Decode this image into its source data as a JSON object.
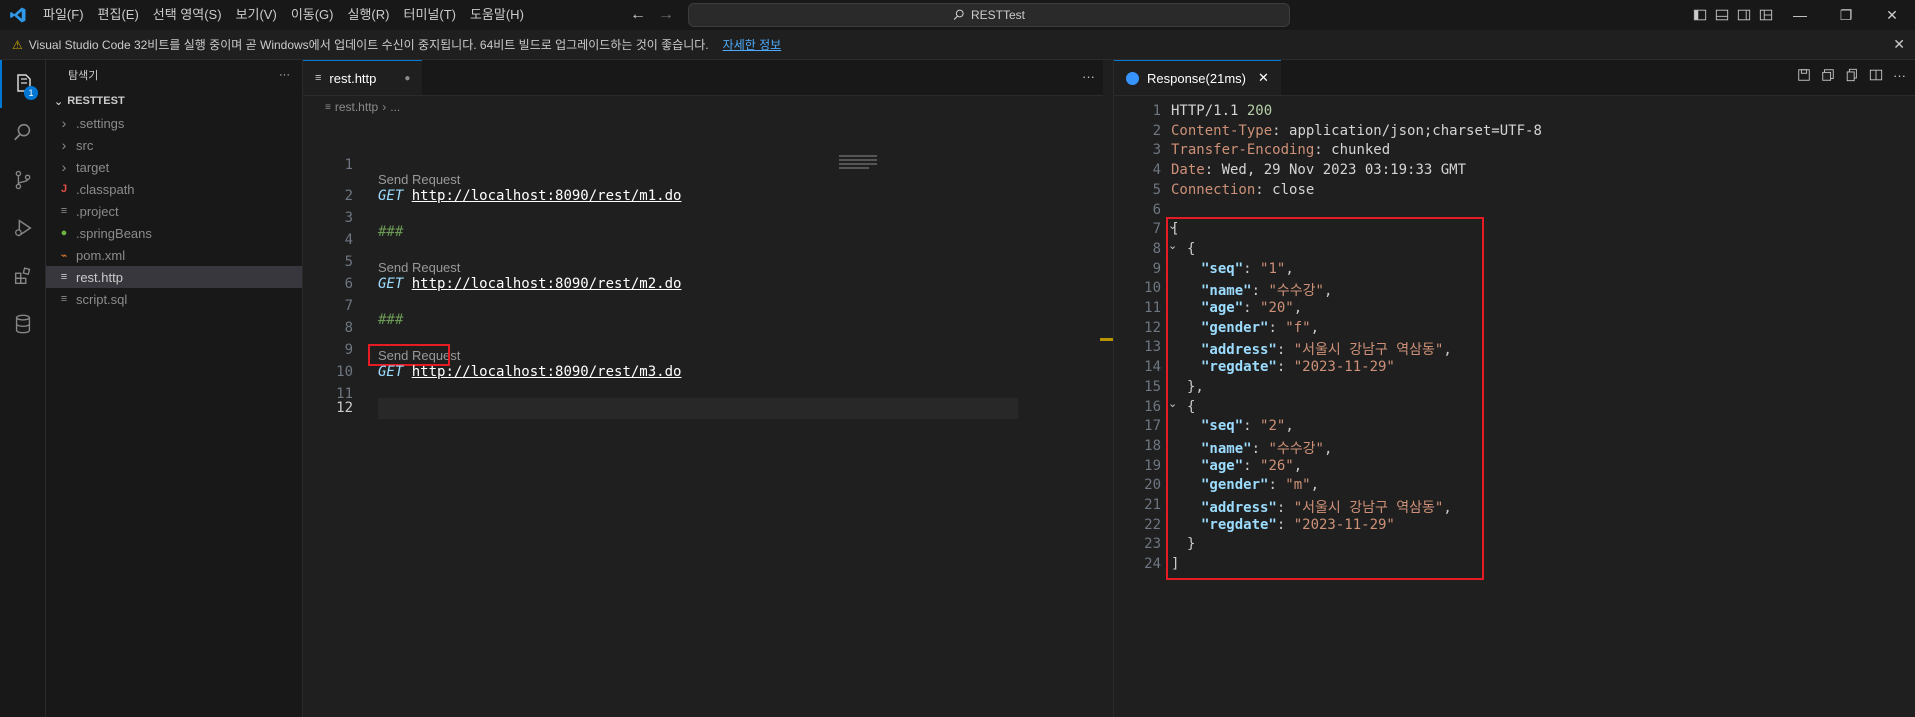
{
  "menu": [
    "파일(F)",
    "편집(E)",
    "선택 영역(S)",
    "보기(V)",
    "이동(G)",
    "실행(R)",
    "터미널(T)",
    "도움말(H)"
  ],
  "search": {
    "text": "RESTTest"
  },
  "notification": {
    "text": "Visual Studio Code 32비트를 실행 중이며 곧 Windows에서 업데이트 수신이 중지됩니다. 64비트 빌드로 업그레이드하는 것이 좋습니다.",
    "link": "자세한 정보"
  },
  "activity": {
    "explorer_badge": "1"
  },
  "sidebar": {
    "title": "탐색기",
    "more": "···",
    "project": "RESTTEST",
    "items": [
      {
        "label": ".settings",
        "icon": "chevron-right-icon",
        "glyph": "›"
      },
      {
        "label": "src",
        "icon": "chevron-right-icon",
        "glyph": "›"
      },
      {
        "label": "target",
        "icon": "chevron-right-icon",
        "glyph": "›"
      },
      {
        "label": ".classpath",
        "icon": "java-icon",
        "glyph": "J"
      },
      {
        "label": ".project",
        "icon": "file-lines-icon",
        "glyph": "≡"
      },
      {
        "label": ".springBeans",
        "icon": "spring-icon",
        "glyph": "●"
      },
      {
        "label": "pom.xml",
        "icon": "rss-icon",
        "glyph": "⌁"
      },
      {
        "label": "rest.http",
        "icon": "file-lines-icon",
        "glyph": "≡"
      },
      {
        "label": "script.sql",
        "icon": "file-lines-icon",
        "glyph": "≡"
      }
    ]
  },
  "editor": {
    "tab_label": "rest.http",
    "breadcrumb": [
      "rest.http",
      "..."
    ],
    "send_request": "Send Request",
    "lines": [
      {
        "n": "1"
      },
      {
        "n": "2"
      },
      {
        "n": "3"
      },
      {
        "n": "4"
      },
      {
        "n": "5"
      },
      {
        "n": "6"
      },
      {
        "n": "7"
      },
      {
        "n": "8"
      },
      {
        "n": "9"
      },
      {
        "n": "10"
      },
      {
        "n": "11"
      },
      {
        "n": "12"
      }
    ],
    "requests": [
      {
        "method": "GET",
        "url": "http://localhost:8090/rest/m1.do"
      },
      {
        "method": "GET",
        "url": "http://localhost:8090/rest/m2.do"
      },
      {
        "method": "GET",
        "url": "http://localhost:8090/rest/m3.do"
      }
    ],
    "separator": "###"
  },
  "response": {
    "tab_label": "Response(21ms)",
    "status_proto": "HTTP/1.1",
    "status_code": "200",
    "headers": [
      {
        "key": "Content-Type",
        "value": "application/json;charset=UTF-8"
      },
      {
        "key": "Transfer-Encoding",
        "value": "chunked"
      },
      {
        "key": "Date",
        "value": "Wed, 29 Nov 2023 03:19:33 GMT"
      },
      {
        "key": "Connection",
        "value": "close"
      }
    ],
    "records": [
      {
        "seq": "1",
        "name": "수수강",
        "age": "20",
        "gender": "f",
        "address": "서울시 강남구 역삼동",
        "regdate": "2023-11-29"
      },
      {
        "seq": "2",
        "name": "수수강",
        "age": "26",
        "gender": "m",
        "address": "서울시 강남구 역삼동",
        "regdate": "2023-11-29"
      }
    ],
    "line_numbers": [
      "1",
      "2",
      "3",
      "4",
      "5",
      "6",
      "7",
      "8",
      "9",
      "10",
      "11",
      "12",
      "13",
      "14",
      "15",
      "16",
      "17",
      "18",
      "19",
      "20",
      "21",
      "22",
      "23",
      "24"
    ]
  },
  "colors": {
    "accent": "#0078d4",
    "highlight_box": "#e51c23"
  }
}
